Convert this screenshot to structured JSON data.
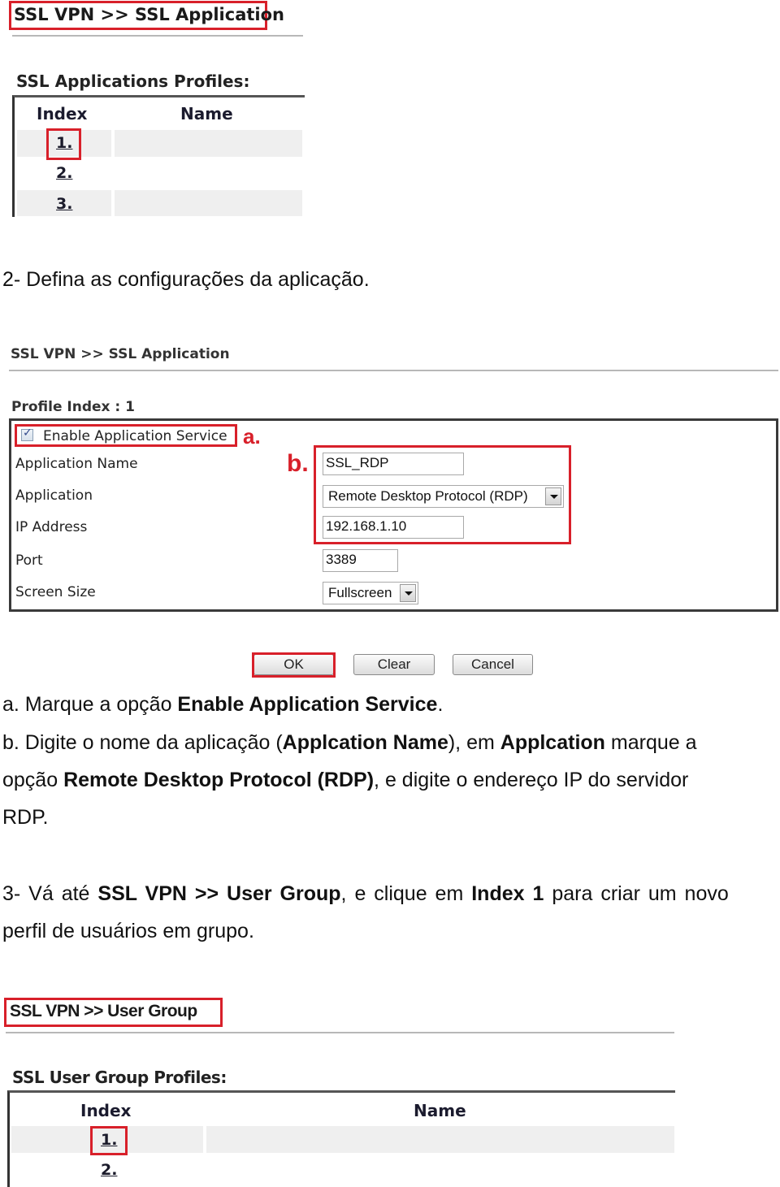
{
  "section1": {
    "breadcrumb": "SSL VPN >> SSL Application",
    "table_title": "SSL Applications Profiles:",
    "columns": [
      "Index",
      "Name"
    ],
    "rows": [
      {
        "index": "1.",
        "name": ""
      },
      {
        "index": "2.",
        "name": ""
      },
      {
        "index": "3.",
        "name": ""
      }
    ]
  },
  "step2": "2- Defina as configurações da aplicação.",
  "section2": {
    "breadcrumb": "SSL VPN >> SSL Application",
    "profile_index": "Profile Index : 1",
    "enable_label": "Enable Application Service",
    "enable_checked": true,
    "annotation_a": "a.",
    "annotation_b": "b.",
    "labels": {
      "app_name": "Application Name",
      "application": "Application",
      "ip": "IP Address",
      "port": "Port",
      "screen": "Screen Size"
    },
    "values": {
      "app_name": "SSL_RDP",
      "application": "Remote Desktop Protocol (RDP)",
      "ip": "192.168.1.10",
      "port": "3389",
      "screen": "Fullscreen"
    },
    "buttons": {
      "ok": "OK",
      "clear": "Clear",
      "cancel": "Cancel"
    }
  },
  "instructions": {
    "a": {
      "prefix": "a. Marque a opção ",
      "bold": "Enable Application Service",
      "suffix": "."
    },
    "b1": {
      "t1": "b. Digite o nome da aplicação (",
      "b1": "Applcation Name",
      "t2": "), em ",
      "b2": "Applcation",
      "t3": " marque a"
    },
    "b2": {
      "t1": "opção ",
      "b1": "Remote Desktop Protocol (RDP)",
      "t2": ", e digite o endereço IP do servidor"
    },
    "b3": "RDP.",
    "step3_l1": {
      "t1": "3- Vá até ",
      "b1": "SSL VPN >> User Group",
      "t2": ", e clique em ",
      "b2": "Index 1",
      "t3": " para criar um novo"
    },
    "step3_l2": "perfil de usuários em grupo."
  },
  "section3": {
    "breadcrumb": "SSL VPN >> User Group",
    "table_title": "SSL User Group Profiles:",
    "columns": [
      "Index",
      "Name"
    ],
    "rows": [
      {
        "index": "1.",
        "name": ""
      },
      {
        "index": "2.",
        "name": ""
      }
    ]
  },
  "colors": {
    "highlight": "#d8202a",
    "row_alt": "#efefef"
  }
}
